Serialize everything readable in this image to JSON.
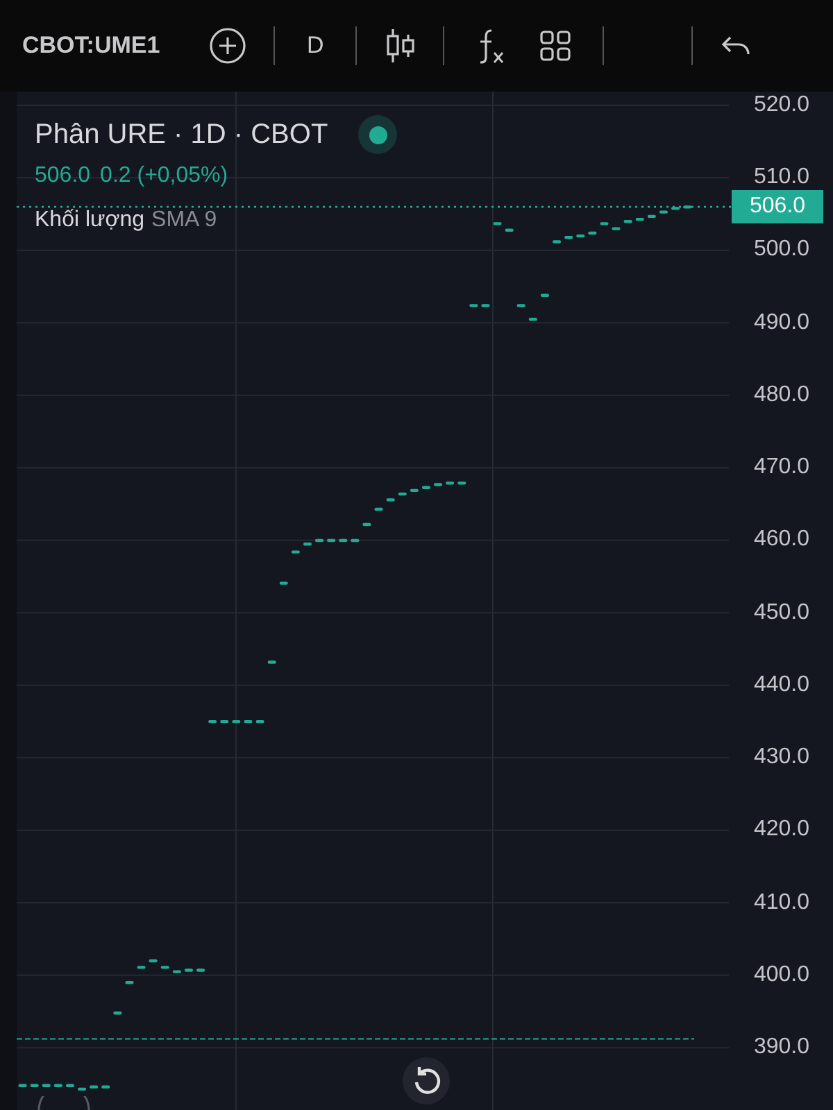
{
  "toolbar": {
    "symbol": "CBOT:UME1",
    "interval": "D"
  },
  "legend": {
    "title": "Phân URE · 1D · CBOT",
    "live": true,
    "price": "506.0",
    "change": "0.2 (+0,05%)",
    "indicator": "Khối lượng",
    "indicator_params": "SMA 9"
  },
  "price_badge": "506.0",
  "chart_data": {
    "type": "scatter",
    "categories": [
      null,
      null,
      null,
      null,
      null,
      null,
      null,
      null,
      null,
      null,
      null,
      null,
      null,
      null,
      null,
      null,
      null,
      null,
      null,
      null,
      null,
      null,
      null,
      null,
      null,
      null,
      null,
      null,
      null,
      null,
      null,
      null,
      null,
      null,
      null,
      null,
      null,
      null,
      null,
      null,
      null,
      null,
      null,
      null,
      null,
      null,
      null,
      null,
      null,
      null,
      null,
      null,
      null,
      null,
      null,
      null,
      null,
      null,
      null,
      null
    ],
    "series": [
      {
        "color": "#22ab94",
        "values": [
          384.8,
          384.8,
          384.8,
          384.8,
          384.8,
          384.3,
          384.6,
          384.6,
          394.8,
          399.0,
          401.1,
          402.0,
          401.1,
          400.5,
          400.7,
          400.7,
          435.0,
          435.0,
          435.0,
          435.0,
          435.0,
          443.2,
          454.1,
          458.4,
          459.5,
          460.0,
          460.0,
          460.0,
          460.0,
          462.2,
          464.3,
          465.6,
          466.4,
          466.9,
          467.3,
          467.7,
          467.9,
          467.9,
          492.4,
          492.4,
          503.7,
          502.8,
          492.4,
          490.5,
          493.8,
          501.2,
          501.8,
          502.0,
          502.4,
          503.7,
          503.0,
          504.0,
          504.3,
          504.7,
          505.3,
          505.8,
          506.0,
          null,
          null,
          null
        ]
      }
    ],
    "yticks": [
      {
        "value": 520,
        "label": "520.0"
      },
      {
        "value": 510,
        "label": "510.0"
      },
      {
        "value": 500,
        "label": "500.0"
      },
      {
        "value": 490,
        "label": "490.0"
      },
      {
        "value": 480,
        "label": "480.0"
      },
      {
        "value": 470,
        "label": "470.0"
      },
      {
        "value": 460,
        "label": "460.0"
      },
      {
        "value": 450,
        "label": "450.0"
      },
      {
        "value": 440,
        "label": "440.0"
      },
      {
        "value": 430,
        "label": "430.0"
      },
      {
        "value": 420,
        "label": "420.0"
      },
      {
        "value": 410,
        "label": "410.0"
      },
      {
        "value": 400,
        "label": "400.0"
      },
      {
        "value": 390,
        "label": "390.0"
      }
    ],
    "ylim": [
      381.4,
      521.9
    ],
    "grid": true,
    "ref_lines": [
      {
        "axis": "y",
        "value": 506.0
      },
      {
        "axis": "y",
        "value": 391.2
      }
    ]
  }
}
